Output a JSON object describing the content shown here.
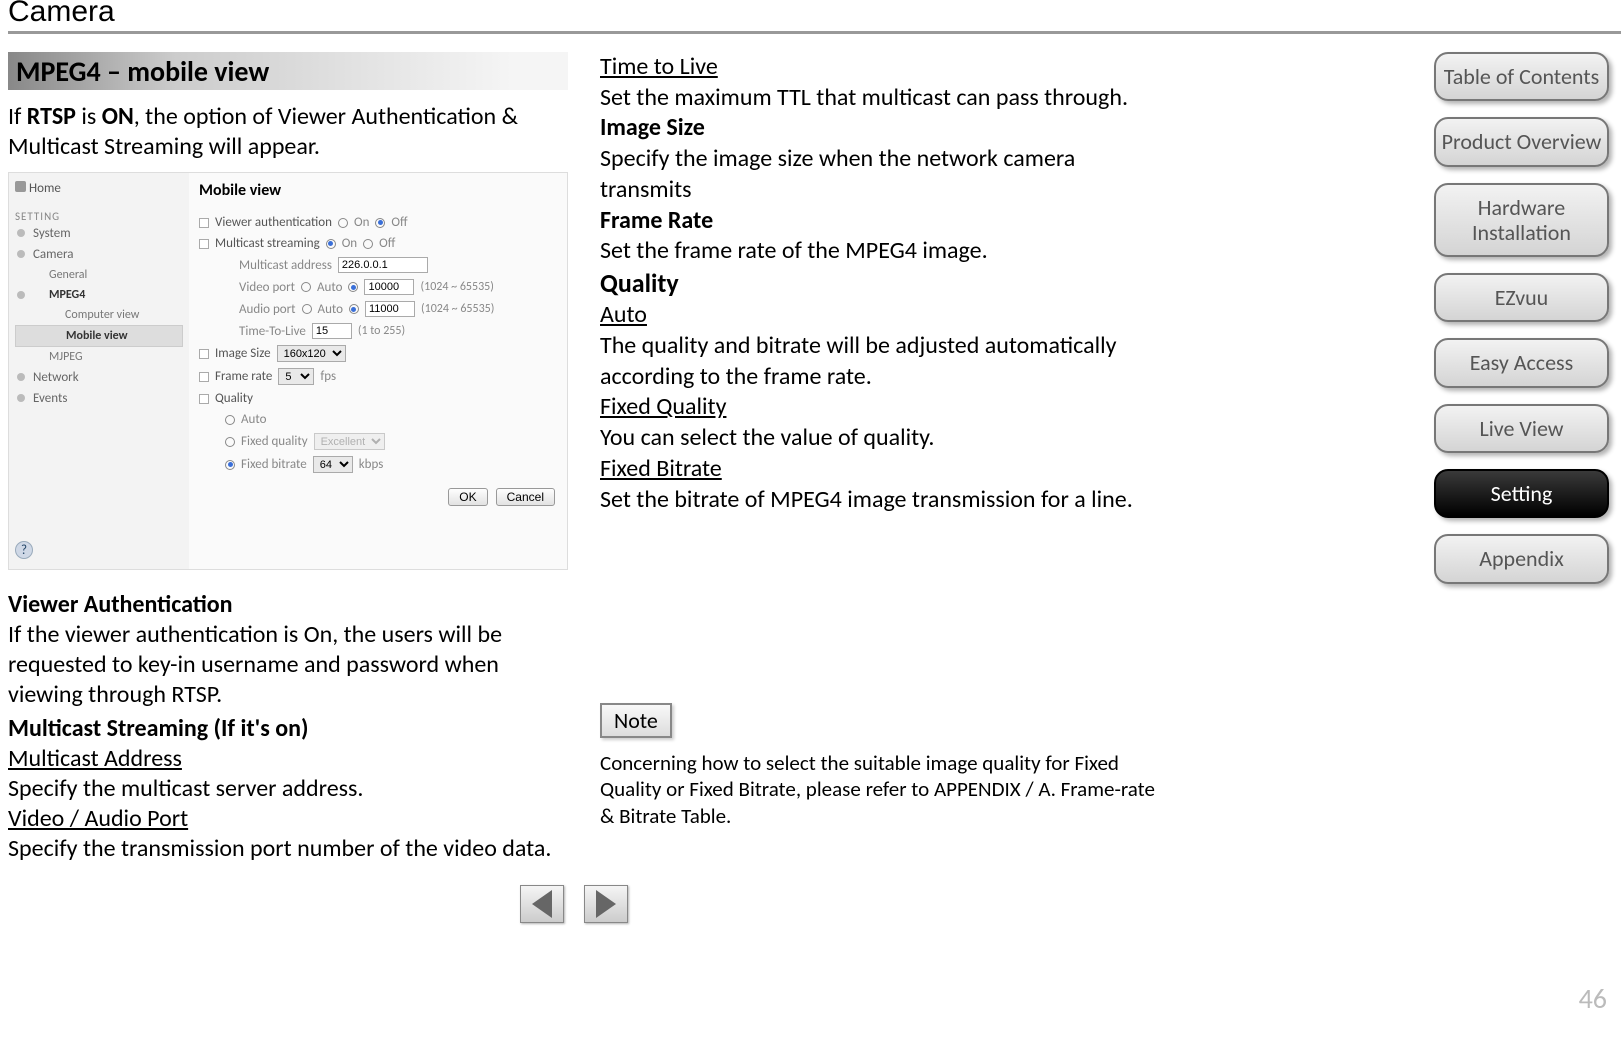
{
  "page_title": "Camera",
  "section_title": "MPEG4 – mobile view",
  "page_number": "46",
  "intro_pre": "If ",
  "intro_b1": "RTSP",
  "intro_mid": " is ",
  "intro_b2": "ON",
  "intro_post": ", the option of Viewer Authentication & Multicast Streaming will appear.",
  "shot": {
    "home": "Home",
    "setting_label": "SETTING",
    "nav": {
      "system": "System",
      "camera": "Camera",
      "general": "General",
      "mpeg4": "MPEG4",
      "computer_view": "Computer view",
      "mobile_view": "Mobile view",
      "mjpeg": "MJPEG",
      "network": "Network",
      "events": "Events"
    },
    "title": "Mobile view",
    "labels": {
      "viewer_auth": "Viewer authentication",
      "multicast": "Multicast streaming",
      "multicast_addr": "Multicast address",
      "video_port": "Video port",
      "audio_port": "Audio port",
      "auto": "Auto",
      "ttl": "Time-To-Live",
      "image_size": "Image Size",
      "frame_rate": "Frame rate",
      "fps": "fps",
      "quality": "Quality",
      "q_auto": "Auto",
      "q_fixed_quality": "Fixed quality",
      "q_fixed_bitrate": "Fixed bitrate",
      "kbps": "kbps",
      "on": "On",
      "off": "Off",
      "port_range": "(1024 ~ 65535)",
      "ttl_range": "(1 to 255)"
    },
    "values": {
      "multicast_addr": "226.0.0.1",
      "video_port": "10000",
      "audio_port": "11000",
      "ttl": "15",
      "image_size": "160x120",
      "frame_rate": "5",
      "fixed_quality": "Excellent",
      "fixed_bitrate": "64"
    },
    "buttons": {
      "ok": "OK",
      "cancel": "Cancel"
    },
    "help": "?"
  },
  "col1": {
    "va_title": "Viewer Authentication",
    "va_text": "If the viewer authentication is On, the users will be requested to key-in username and password when viewing through RTSP.",
    "ms_title": "Multicast Streaming (If it's on)",
    "ma_title": "Multicast Address",
    "ma_text": "Specify the multicast server address.",
    "vap_title": "Video / Audio Port",
    "vap_text": "Specify the transmission port number of the video data."
  },
  "col2": {
    "ttl_title": "Time to Live",
    "ttl_text": "Set the maximum TTL that multicast can pass through.",
    "is_title": "Image Size",
    "is_text": "Specify the image size when the network camera transmits",
    "fr_title": "Frame Rate",
    "fr_text": "Set the frame rate of the MPEG4 image.",
    "q_title": "Quality",
    "auto_title": "Auto",
    "auto_text": "The quality and bitrate will be adjusted automatically according to the frame rate.",
    "fq_title": "Fixed Quality",
    "fq_text": "You can select the value of quality.",
    "fb_title": "Fixed Bitrate",
    "fb_text": "Set the bitrate of MPEG4 image transmission for a line."
  },
  "note": {
    "label": "Note",
    "text": "Concerning how to select the suitable image quality for Fixed Quality or Fixed Bitrate, please refer to APPENDIX / A. Frame-rate & Bitrate Table."
  },
  "sidenav": {
    "toc": "Table of Contents",
    "overview": "Product Overview",
    "hw": "Hardware Installation",
    "ezvuu": "EZvuu",
    "easy": "Easy Access",
    "live": "Live View",
    "setting": "Setting",
    "appendix": "Appendix"
  }
}
